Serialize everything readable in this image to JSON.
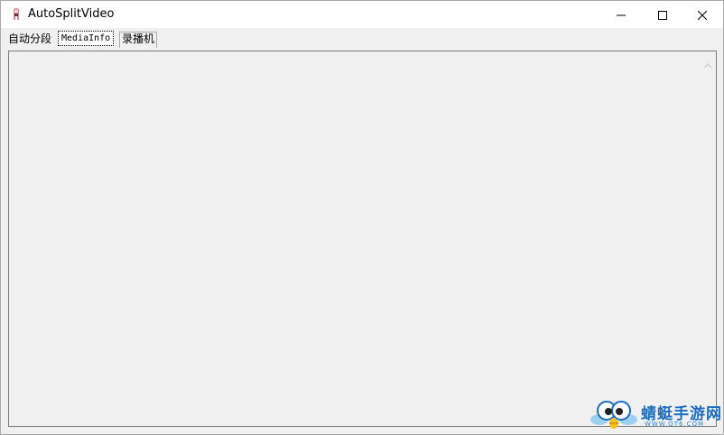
{
  "window": {
    "title": "AutoSplitVideo",
    "icon": "app-icon",
    "controls": [
      "minimize-icon",
      "maximize-icon",
      "close-icon"
    ]
  },
  "tabs": [
    {
      "label": "自动分段",
      "selected": false
    },
    {
      "label": "MediaInfo",
      "selected": true
    },
    {
      "label": "录播机",
      "selected": false
    }
  ],
  "content": {
    "text": "",
    "scrollbar": "vertical"
  },
  "watermark": {
    "text": "蜻蜓手游网",
    "url": "WWW.QT6.COM"
  }
}
